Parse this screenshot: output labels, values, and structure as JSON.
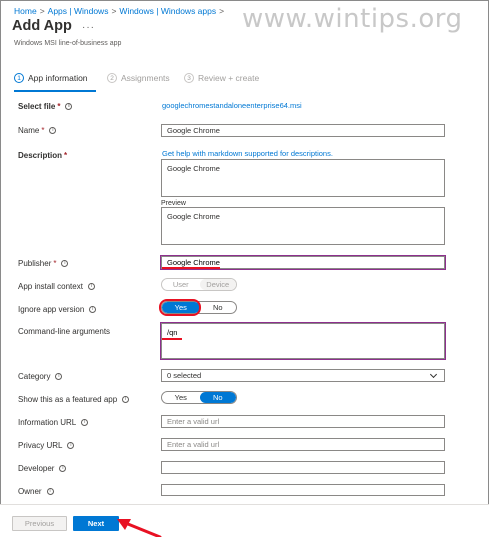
{
  "watermark": "www.wintips.org",
  "breadcrumb": [
    "Home",
    "Apps | Windows",
    "Windows | Windows apps"
  ],
  "breadcrumb_sep": ">",
  "page": {
    "title": "Add App",
    "more": "···",
    "subtitle": "Windows MSI line-of-business app"
  },
  "steps": [
    {
      "num": "1",
      "label": "App information"
    },
    {
      "num": "2",
      "label": "Assignments"
    },
    {
      "num": "3",
      "label": "Review + create"
    }
  ],
  "form": {
    "select_file": {
      "label": "Select file",
      "required": "*",
      "value": "googlechromestandaloneenterprise64.msi"
    },
    "name": {
      "label": "Name",
      "required": "*",
      "value": "Google Chrome"
    },
    "description": {
      "label": "Description",
      "required": "*",
      "help_link": "Get help with markdown supported for descriptions.",
      "value": "Google Chrome",
      "preview_label": "Preview",
      "preview_value": "Google Chrome"
    },
    "publisher": {
      "label": "Publisher",
      "required": "*",
      "value": "Google Chrome"
    },
    "install_context": {
      "label": "App install context",
      "options": [
        "User",
        "Device"
      ]
    },
    "ignore_version": {
      "label": "Ignore app version",
      "options": [
        "Yes",
        "No"
      ],
      "selected": "Yes"
    },
    "cmdline": {
      "label": "Command-line arguments",
      "value": "/qn"
    },
    "category": {
      "label": "Category",
      "value": "0 selected"
    },
    "featured": {
      "label": "Show this as a featured app",
      "options": [
        "Yes",
        "No"
      ],
      "selected": "No"
    },
    "info_url": {
      "label": "Information URL",
      "placeholder": "Enter a valid url"
    },
    "privacy_url": {
      "label": "Privacy URL",
      "placeholder": "Enter a valid url"
    },
    "developer": {
      "label": "Developer",
      "value": ""
    },
    "owner": {
      "label": "Owner",
      "value": ""
    }
  },
  "footer": {
    "previous": "Previous",
    "next": "Next"
  },
  "info_glyph": "i",
  "colors": {
    "accent": "#0078d4",
    "annotation": "#e81123",
    "focus": "#8e2f8e"
  }
}
